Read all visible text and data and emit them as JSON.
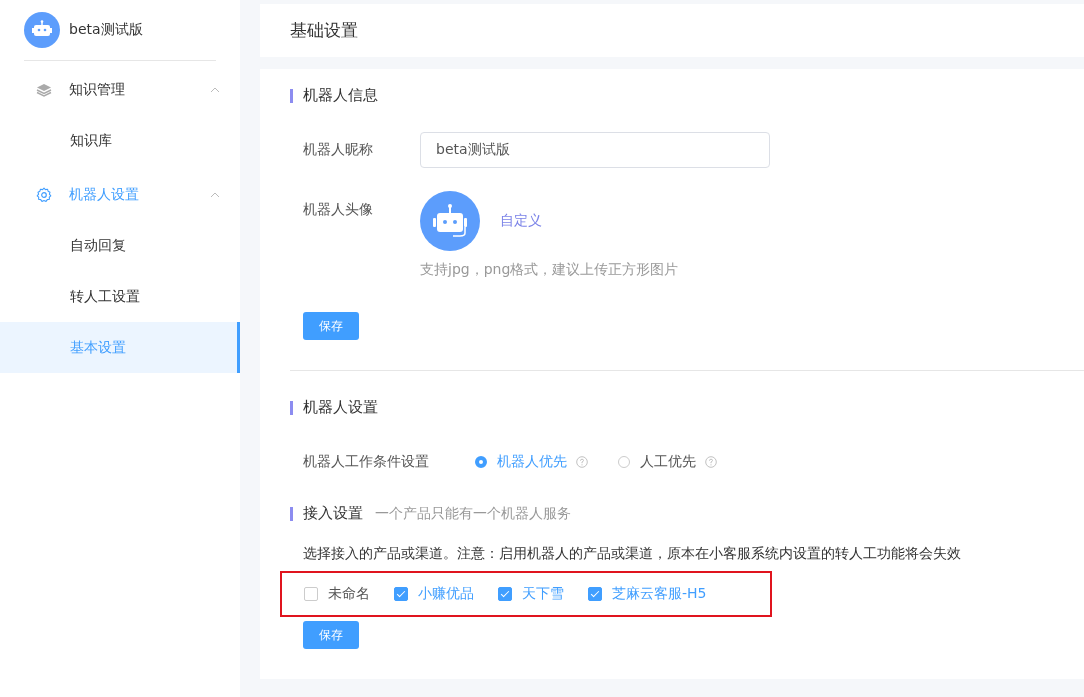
{
  "sidebar": {
    "bot_name": "beta测试版",
    "groups": [
      {
        "label": "知识管理",
        "kind": "layers",
        "expanded": true,
        "active": false,
        "children": [
          {
            "label": "知识库",
            "selected": false
          }
        ]
      },
      {
        "label": "机器人设置",
        "kind": "gear",
        "expanded": true,
        "active": true,
        "children": [
          {
            "label": "自动回复",
            "selected": false
          },
          {
            "label": "转人工设置",
            "selected": false
          },
          {
            "label": "基本设置",
            "selected": true
          }
        ]
      }
    ]
  },
  "page_title": "基础设置",
  "bot_info": {
    "title": "机器人信息",
    "nickname_label": "机器人昵称",
    "nickname_value": "beta测试版",
    "avatar_label": "机器人头像",
    "customize_link": "自定义",
    "avatar_hint": "支持jpg，png格式，建议上传正方形图片",
    "save_button": "保存"
  },
  "bot_settings": {
    "title": "机器人设置",
    "condition_label": "机器人工作条件设置",
    "options": [
      {
        "label": "机器人优先",
        "selected": true
      },
      {
        "label": "人工优先",
        "selected": false
      }
    ]
  },
  "access": {
    "title": "接入设置",
    "subtitle": "一个产品只能有一个机器人服务",
    "notice": "选择接入的产品或渠道。注意：启用机器人的产品或渠道，原本在小客服系统内设置的转人工功能将会失效",
    "channels": [
      {
        "label": "未命名",
        "checked": false
      },
      {
        "label": "小赚优品",
        "checked": true
      },
      {
        "label": "天下雪",
        "checked": true
      },
      {
        "label": "芝麻云客服-H5",
        "checked": true
      }
    ],
    "save_button": "保存"
  }
}
